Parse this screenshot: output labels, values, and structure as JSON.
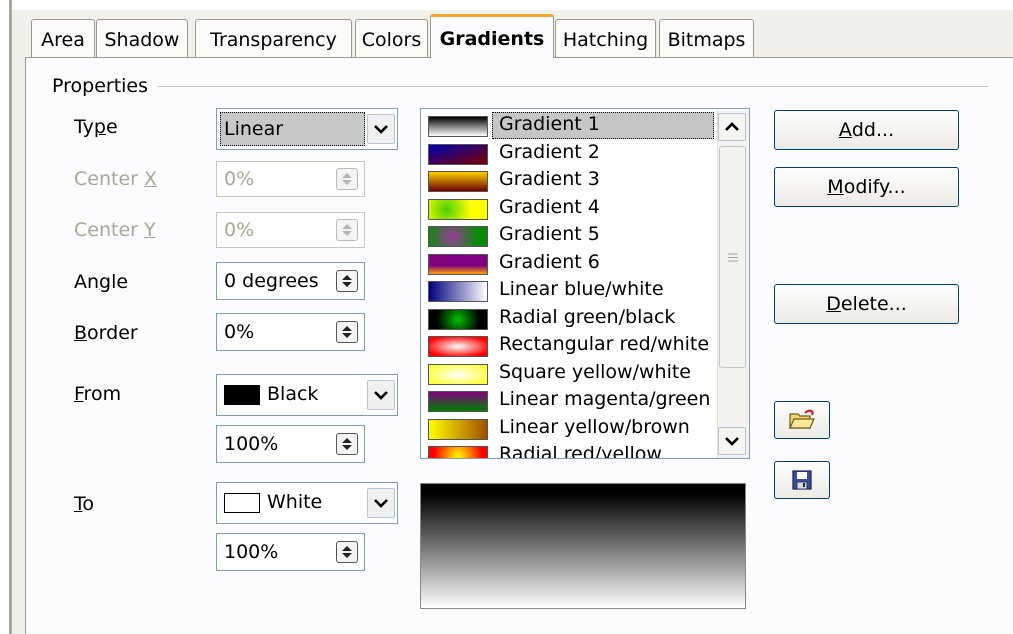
{
  "tabs": [
    "Area",
    "Shadow",
    "Transparency",
    "Colors",
    "Gradients",
    "Hatching",
    "Bitmaps"
  ],
  "active_tab": "Gradients",
  "group": {
    "title": "Properties"
  },
  "type": {
    "label_pre": "Ty",
    "label_u": "p",
    "label_post": "e",
    "value": "Linear"
  },
  "center_x": {
    "label_pre": "Center ",
    "label_u": "X",
    "value": "0%"
  },
  "center_y": {
    "label_pre": "Center ",
    "label_u": "Y",
    "value": "0%"
  },
  "angle": {
    "label_pre": "An",
    "label_u": "g",
    "label_post": "le",
    "value": "0 degrees"
  },
  "border": {
    "label_u": "B",
    "label_post": "order",
    "value": "0%"
  },
  "from": {
    "label_u": "F",
    "label_post": "rom",
    "color_name": "Black",
    "color": "#000000",
    "intensity": "100%"
  },
  "to": {
    "label_u": "T",
    "label_post": "o",
    "color_name": "White",
    "color": "#ffffff",
    "intensity": "100%"
  },
  "gradients": [
    {
      "name": "Gradient 1",
      "selected": true,
      "swatch": "linear-gradient(to bottom,#000,#fff)"
    },
    {
      "name": "Gradient 2",
      "swatch": "linear-gradient(to bottom right,#0000b0,#7a0000)"
    },
    {
      "name": "Gradient 3",
      "swatch": "linear-gradient(to bottom,#ffd000,#6b0000)"
    },
    {
      "name": "Gradient 4",
      "swatch": "radial-gradient(circle at 30% 50%,#4cd000,#ffff00 60%)"
    },
    {
      "name": "Gradient 5",
      "swatch": "radial-gradient(circle at 40% 50%,#9b3a9b,#0a8a0a 70%)"
    },
    {
      "name": "Gradient 6",
      "swatch": "linear-gradient(to bottom,#800080,#800080 55%,#ffa500)"
    },
    {
      "name": "Linear blue/white",
      "swatch": "linear-gradient(to right,#000080,#ffffff)"
    },
    {
      "name": "Radial green/black",
      "swatch": "radial-gradient(circle,#00c000,#000000 70%)"
    },
    {
      "name": "Rectangular red/white",
      "swatch": "radial-gradient(ellipse,#ffffff,#ff0000 80%)"
    },
    {
      "name": "Square yellow/white",
      "swatch": "radial-gradient(ellipse,#ffffff,#ffff40 80%)"
    },
    {
      "name": "Linear magenta/green",
      "swatch": "linear-gradient(to bottom,#800080,#008000)"
    },
    {
      "name": "Linear yellow/brown",
      "swatch": "linear-gradient(to right,#ffff00,#a05000)"
    },
    {
      "name": "Radial red/yellow",
      "swatch": "radial-gradient(circle,#ffff00,#ff0000 80%)"
    }
  ],
  "buttons": {
    "add": {
      "u": "A",
      "rest": "dd..."
    },
    "modify": {
      "u": "M",
      "rest": "odify..."
    },
    "delete": {
      "u": "D",
      "rest": "elete..."
    }
  },
  "icons": {
    "open": "folder-open-icon",
    "save": "floppy-save-icon"
  }
}
